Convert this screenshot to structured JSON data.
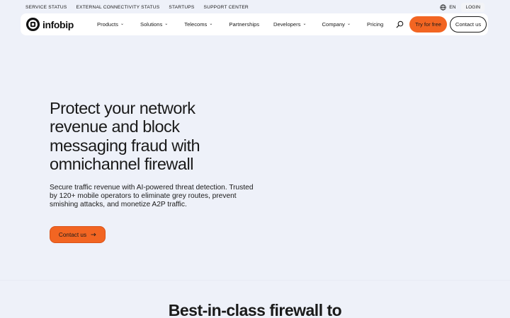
{
  "utility_bar": {
    "links": [
      "SERVICE STATUS",
      "EXTERNAL CONNECTIVITY STATUS",
      "STARTUPS",
      "SUPPORT CENTER"
    ],
    "language": "EN",
    "language_icon": "globe-icon",
    "login": "LOGIN"
  },
  "nav": {
    "logo_text": "infobip",
    "items": [
      {
        "label": "Products",
        "has_dropdown": true
      },
      {
        "label": "Solutions",
        "has_dropdown": true
      },
      {
        "label": "Telecoms",
        "has_dropdown": true
      },
      {
        "label": "Partnerships",
        "has_dropdown": false
      },
      {
        "label": "Developers",
        "has_dropdown": true
      },
      {
        "label": "Company",
        "has_dropdown": true
      },
      {
        "label": "Pricing",
        "has_dropdown": false
      }
    ],
    "search_icon": "search-icon",
    "try_button": "Try for free",
    "contact_button": "Contact us"
  },
  "hero": {
    "title": "Protect your network revenue and block messaging fraud with omnichannel firewall",
    "subtitle": "Secure traffic revenue with AI-powered threat detection. Trusted by 120+ mobile operators to eliminate grey routes, prevent smishing attacks, and monetize A2P traffic.",
    "cta_label": "Contact us",
    "cta_icon": "arrow-right-icon"
  },
  "next_section": {
    "heading": "Best-in-class firewall to"
  },
  "colors": {
    "page_bg": "#eef1f9",
    "accent": "#f26522",
    "text": "#1a1a1a",
    "nav_bg": "#ffffff"
  }
}
